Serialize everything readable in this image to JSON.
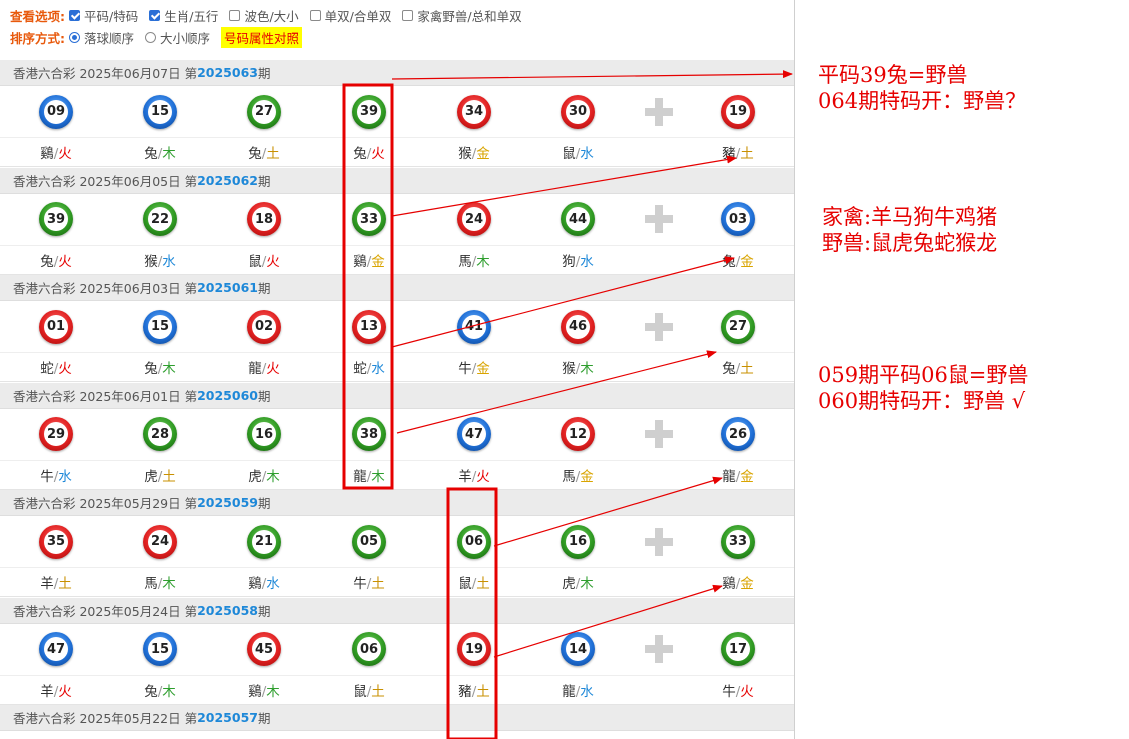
{
  "options": {
    "view_label": "查看选项:",
    "checkboxes": [
      {
        "label": "平码/特码",
        "checked": true
      },
      {
        "label": "生肖/五行",
        "checked": true
      },
      {
        "label": "波色/大小",
        "checked": false
      },
      {
        "label": "单双/合单双",
        "checked": false
      },
      {
        "label": "家禽野兽/总和单双",
        "checked": false
      }
    ],
    "sort_label": "排序方式:",
    "sort_options": [
      {
        "label": "落球顺序",
        "selected": true
      },
      {
        "label": "大小顺序",
        "selected": false
      }
    ],
    "compare_button": "号码属性对照"
  },
  "colors": {
    "ball_red": "#e02020",
    "ball_blue": "#1f6fd6",
    "ball_green": "#2f9a22",
    "element_fire": "#e60000",
    "element_wood": "#2e9e2e",
    "element_earth": "#c89000",
    "element_metal": "#d9a400",
    "element_water": "#1e88d8",
    "issue_blue": "#1e88d8",
    "annotation_red": "#e60000"
  },
  "draws": [
    {
      "head_prefix": "香港六合彩 2025年06月07日 第",
      "issue": "2025063",
      "head_suffix": "期",
      "balls": [
        {
          "num": "09",
          "color": "blue",
          "zodiac": "鷄",
          "element": "火",
          "el": "fire"
        },
        {
          "num": "15",
          "color": "blue",
          "zodiac": "兔",
          "element": "木",
          "el": "wood"
        },
        {
          "num": "27",
          "color": "green",
          "zodiac": "兔",
          "element": "土",
          "el": "earth"
        },
        {
          "num": "39",
          "color": "green",
          "zodiac": "兔",
          "element": "火",
          "el": "fire"
        },
        {
          "num": "34",
          "color": "red",
          "zodiac": "猴",
          "element": "金",
          "el": "metal"
        },
        {
          "num": "30",
          "color": "red",
          "zodiac": "鼠",
          "element": "水",
          "el": "water"
        },
        {
          "num": "19",
          "color": "red",
          "zodiac": "豬",
          "element": "土",
          "el": "earth"
        }
      ]
    },
    {
      "head_prefix": "香港六合彩 2025年06月05日 第",
      "issue": "2025062",
      "head_suffix": "期",
      "balls": [
        {
          "num": "39",
          "color": "green",
          "zodiac": "兔",
          "element": "火",
          "el": "fire"
        },
        {
          "num": "22",
          "color": "green",
          "zodiac": "猴",
          "element": "水",
          "el": "water"
        },
        {
          "num": "18",
          "color": "red",
          "zodiac": "鼠",
          "element": "火",
          "el": "fire"
        },
        {
          "num": "33",
          "color": "green",
          "zodiac": "鷄",
          "element": "金",
          "el": "metal"
        },
        {
          "num": "24",
          "color": "red",
          "zodiac": "馬",
          "element": "木",
          "el": "wood"
        },
        {
          "num": "44",
          "color": "green",
          "zodiac": "狗",
          "element": "水",
          "el": "water"
        },
        {
          "num": "03",
          "color": "blue",
          "zodiac": "兔",
          "element": "金",
          "el": "metal"
        }
      ]
    },
    {
      "head_prefix": "香港六合彩 2025年06月03日 第",
      "issue": "2025061",
      "head_suffix": "期",
      "balls": [
        {
          "num": "01",
          "color": "red",
          "zodiac": "蛇",
          "element": "火",
          "el": "fire"
        },
        {
          "num": "15",
          "color": "blue",
          "zodiac": "兔",
          "element": "木",
          "el": "wood"
        },
        {
          "num": "02",
          "color": "red",
          "zodiac": "龍",
          "element": "火",
          "el": "fire"
        },
        {
          "num": "13",
          "color": "red",
          "zodiac": "蛇",
          "element": "水",
          "el": "water"
        },
        {
          "num": "41",
          "color": "blue",
          "zodiac": "牛",
          "element": "金",
          "el": "metal"
        },
        {
          "num": "46",
          "color": "red",
          "zodiac": "猴",
          "element": "木",
          "el": "wood"
        },
        {
          "num": "27",
          "color": "green",
          "zodiac": "兔",
          "element": "土",
          "el": "earth"
        }
      ]
    },
    {
      "head_prefix": "香港六合彩 2025年06月01日 第",
      "issue": "2025060",
      "head_suffix": "期",
      "balls": [
        {
          "num": "29",
          "color": "red",
          "zodiac": "牛",
          "element": "水",
          "el": "water"
        },
        {
          "num": "28",
          "color": "green",
          "zodiac": "虎",
          "element": "土",
          "el": "earth"
        },
        {
          "num": "16",
          "color": "green",
          "zodiac": "虎",
          "element": "木",
          "el": "wood"
        },
        {
          "num": "38",
          "color": "green",
          "zodiac": "龍",
          "element": "木",
          "el": "wood"
        },
        {
          "num": "47",
          "color": "blue",
          "zodiac": "羊",
          "element": "火",
          "el": "fire"
        },
        {
          "num": "12",
          "color": "red",
          "zodiac": "馬",
          "element": "金",
          "el": "metal"
        },
        {
          "num": "26",
          "color": "blue",
          "zodiac": "龍",
          "element": "金",
          "el": "metal"
        }
      ]
    },
    {
      "head_prefix": "香港六合彩 2025年05月29日 第",
      "issue": "2025059",
      "head_suffix": "期",
      "balls": [
        {
          "num": "35",
          "color": "red",
          "zodiac": "羊",
          "element": "土",
          "el": "earth"
        },
        {
          "num": "24",
          "color": "red",
          "zodiac": "馬",
          "element": "木",
          "el": "wood"
        },
        {
          "num": "21",
          "color": "green",
          "zodiac": "鷄",
          "element": "水",
          "el": "water"
        },
        {
          "num": "05",
          "color": "green",
          "zodiac": "牛",
          "element": "土",
          "el": "earth"
        },
        {
          "num": "06",
          "color": "green",
          "zodiac": "鼠",
          "element": "土",
          "el": "earth"
        },
        {
          "num": "16",
          "color": "green",
          "zodiac": "虎",
          "element": "木",
          "el": "wood"
        },
        {
          "num": "33",
          "color": "green",
          "zodiac": "鷄",
          "element": "金",
          "el": "metal"
        }
      ]
    },
    {
      "head_prefix": "香港六合彩 2025年05月24日 第",
      "issue": "2025058",
      "head_suffix": "期",
      "balls": [
        {
          "num": "47",
          "color": "blue",
          "zodiac": "羊",
          "element": "火",
          "el": "fire"
        },
        {
          "num": "15",
          "color": "blue",
          "zodiac": "兔",
          "element": "木",
          "el": "wood"
        },
        {
          "num": "45",
          "color": "red",
          "zodiac": "鷄",
          "element": "木",
          "el": "wood"
        },
        {
          "num": "06",
          "color": "green",
          "zodiac": "鼠",
          "element": "土",
          "el": "earth"
        },
        {
          "num": "19",
          "color": "red",
          "zodiac": "豬",
          "element": "土",
          "el": "earth"
        },
        {
          "num": "14",
          "color": "blue",
          "zodiac": "龍",
          "element": "水",
          "el": "water"
        },
        {
          "num": "17",
          "color": "green",
          "zodiac": "牛",
          "element": "火",
          "el": "fire"
        }
      ]
    },
    {
      "head_prefix": "香港六合彩 2025年05月22日 第",
      "issue": "2025057",
      "head_suffix": "期",
      "balls": []
    }
  ],
  "annotations": {
    "note1": [
      "平码39兔=野兽",
      "064期特码开：野兽？"
    ],
    "note2": [
      "家禽:羊马狗牛鸡猪",
      "野兽:鼠虎兔蛇猴龙"
    ],
    "note3": [
      "059期平码06鼠=野兽",
      "060期特码开：野兽 √"
    ]
  }
}
